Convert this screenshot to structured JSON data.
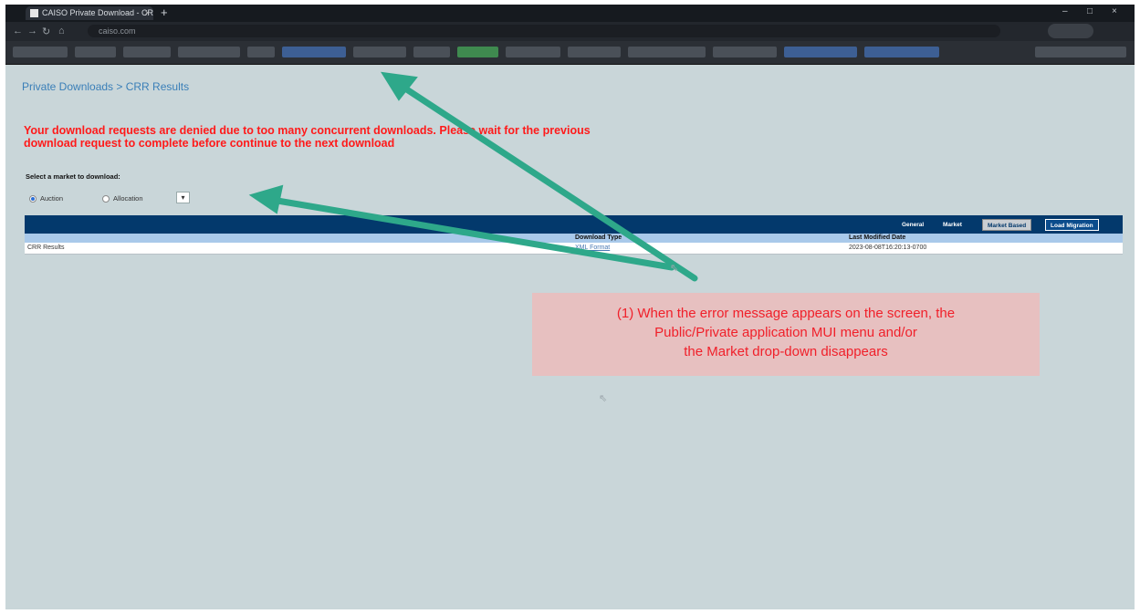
{
  "browser": {
    "tab_title": "CAISO Private Download - CRR",
    "tab_close": "×",
    "new_tab": "+",
    "window_controls": [
      "–",
      "□",
      "×"
    ],
    "url": "caiso.com"
  },
  "page": {
    "breadcrumb": "Private Downloads > CRR Results",
    "error_message": "Your download requests are denied due to too many concurrent downloads. Please wait for the previous download request to complete before continue to the next download",
    "select_market_label": "Select a market to download:",
    "markets": [
      {
        "label": "Auction",
        "selected": true
      },
      {
        "label": "Allocation",
        "selected": false
      }
    ],
    "dropdown_glyph": "▾",
    "tabs": [
      {
        "label": "General",
        "state": "normal"
      },
      {
        "label": "Market",
        "state": "normal"
      },
      {
        "label": "Market Based",
        "state": "active"
      },
      {
        "label": "Load Migration",
        "state": "navy"
      }
    ],
    "table": {
      "headers": [
        "Download Type",
        "Last Modified Date"
      ],
      "rows": [
        {
          "name": "CRR Results",
          "download_type": "XML Format",
          "last_modified": "2023-08-08T16:20:13-0700"
        }
      ]
    }
  },
  "annotation": {
    "text_line1": "(1) When the error message appears on the screen, the",
    "text_line2": "Public/Private application MUI menu and/or",
    "text_line3": "the Market drop-down disappears",
    "arrow_color": "#2ea88a",
    "callout_color": "#e7c0c0",
    "text_color": "#f0202a"
  },
  "colors": {
    "page_bg": "#c9d6d9",
    "header_navy": "#03396c",
    "column_header": "#a9c9ea",
    "error_red": "#ff1a1a",
    "link_blue": "#3a7fb8"
  }
}
